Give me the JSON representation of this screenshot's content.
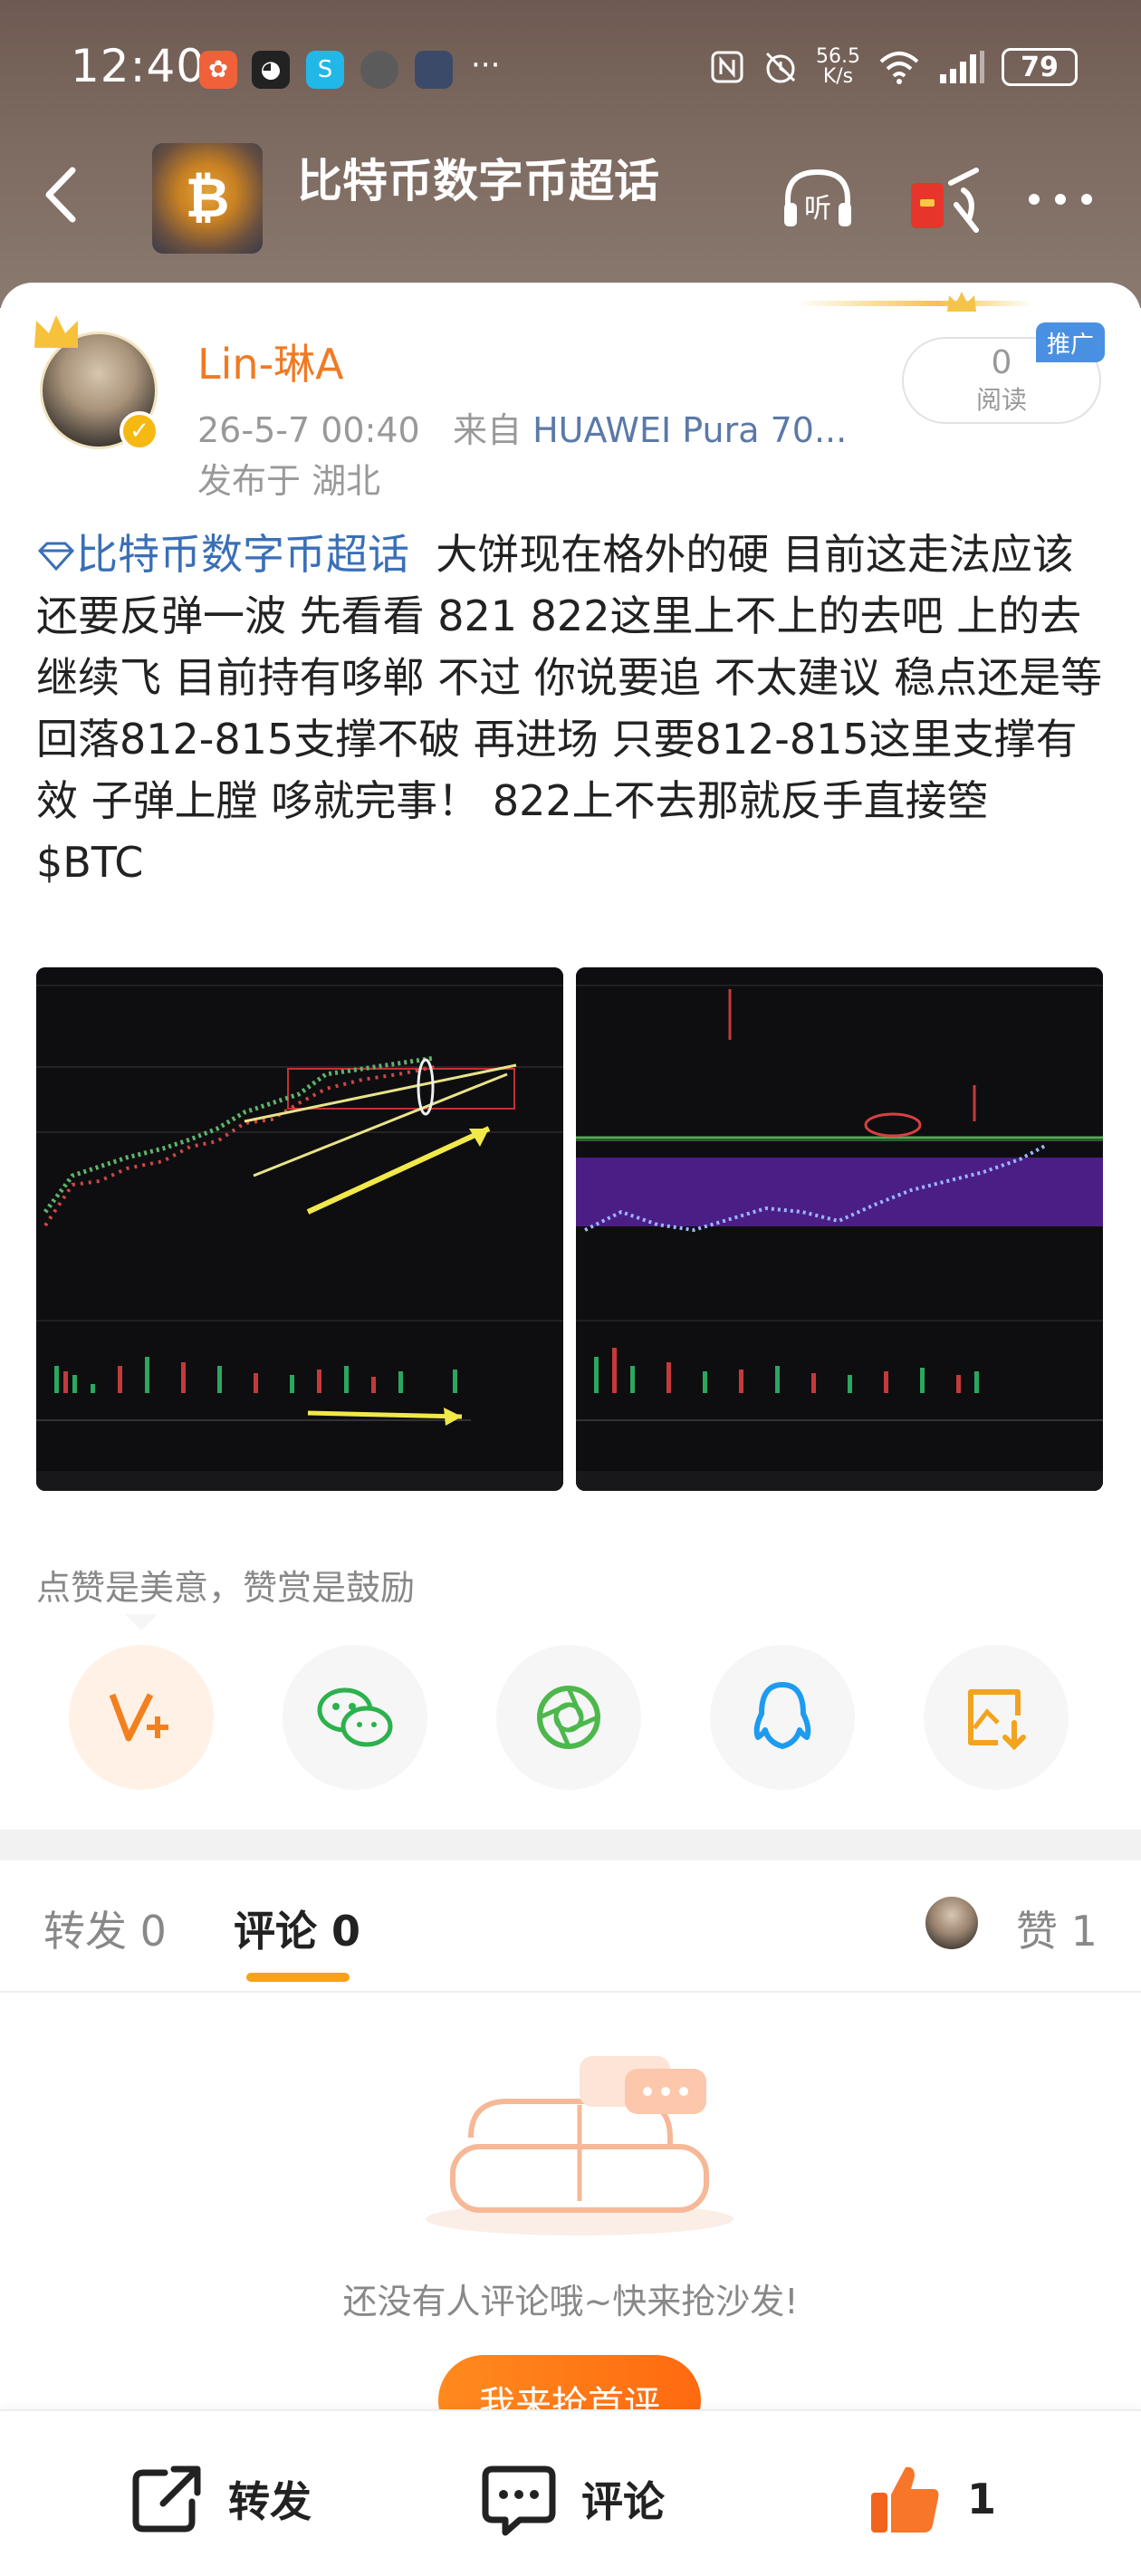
{
  "status_bar": {
    "time": "12:40",
    "net_speed_value": "56.5",
    "net_speed_unit": "K/s",
    "battery": "79",
    "more": "···"
  },
  "topbar": {
    "title": "比特币数字币超话",
    "listen_label": "听"
  },
  "post": {
    "username": "Lin-琳A",
    "date": "26-5-7 00:40",
    "source_prefix": "来自",
    "device": "HUAWEI Pura 70...",
    "location": "发布于 湖北",
    "read_count": "0",
    "read_label": "阅读",
    "promo_tag": "推广",
    "topic_link": "比特币数字币超话",
    "body": "大饼现在格外的硬  目前这走法应该还要反弹一波 先看看 821 822这里上不上的去吧 上的去 继续飞  目前持有哆郸 不过 你说要追 不太建议 稳点还是等回落812-815支撑不破  再进场 只要812-815这里支撑有效  子弹上膛 哆就完事！ 822上不去那就反手直接箜",
    "ticker": "$BTC"
  },
  "appreciate_text": "点赞是美意，赞赏是鼓励",
  "share_buttons": [
    {
      "name": "reward",
      "icon": "v-plus-icon"
    },
    {
      "name": "wechat",
      "icon": "wechat-icon"
    },
    {
      "name": "moments",
      "icon": "aperture-icon"
    },
    {
      "name": "qq",
      "icon": "qq-penguin-icon"
    },
    {
      "name": "save-image",
      "icon": "image-download-icon"
    }
  ],
  "tabs": {
    "repost": "转发 0",
    "comments": "评论 0",
    "likes": "赞 1"
  },
  "empty_state": {
    "text": "还没有人评论哦~快来抢沙发!",
    "button": "我来抢首评"
  },
  "bottom_bar": {
    "repost": "转发",
    "comment": "评论",
    "like_count": "1"
  },
  "colors": {
    "accent_orange": "#f07a22",
    "link_blue": "#3a6fb7",
    "tab_underline": "#f7a21a"
  }
}
